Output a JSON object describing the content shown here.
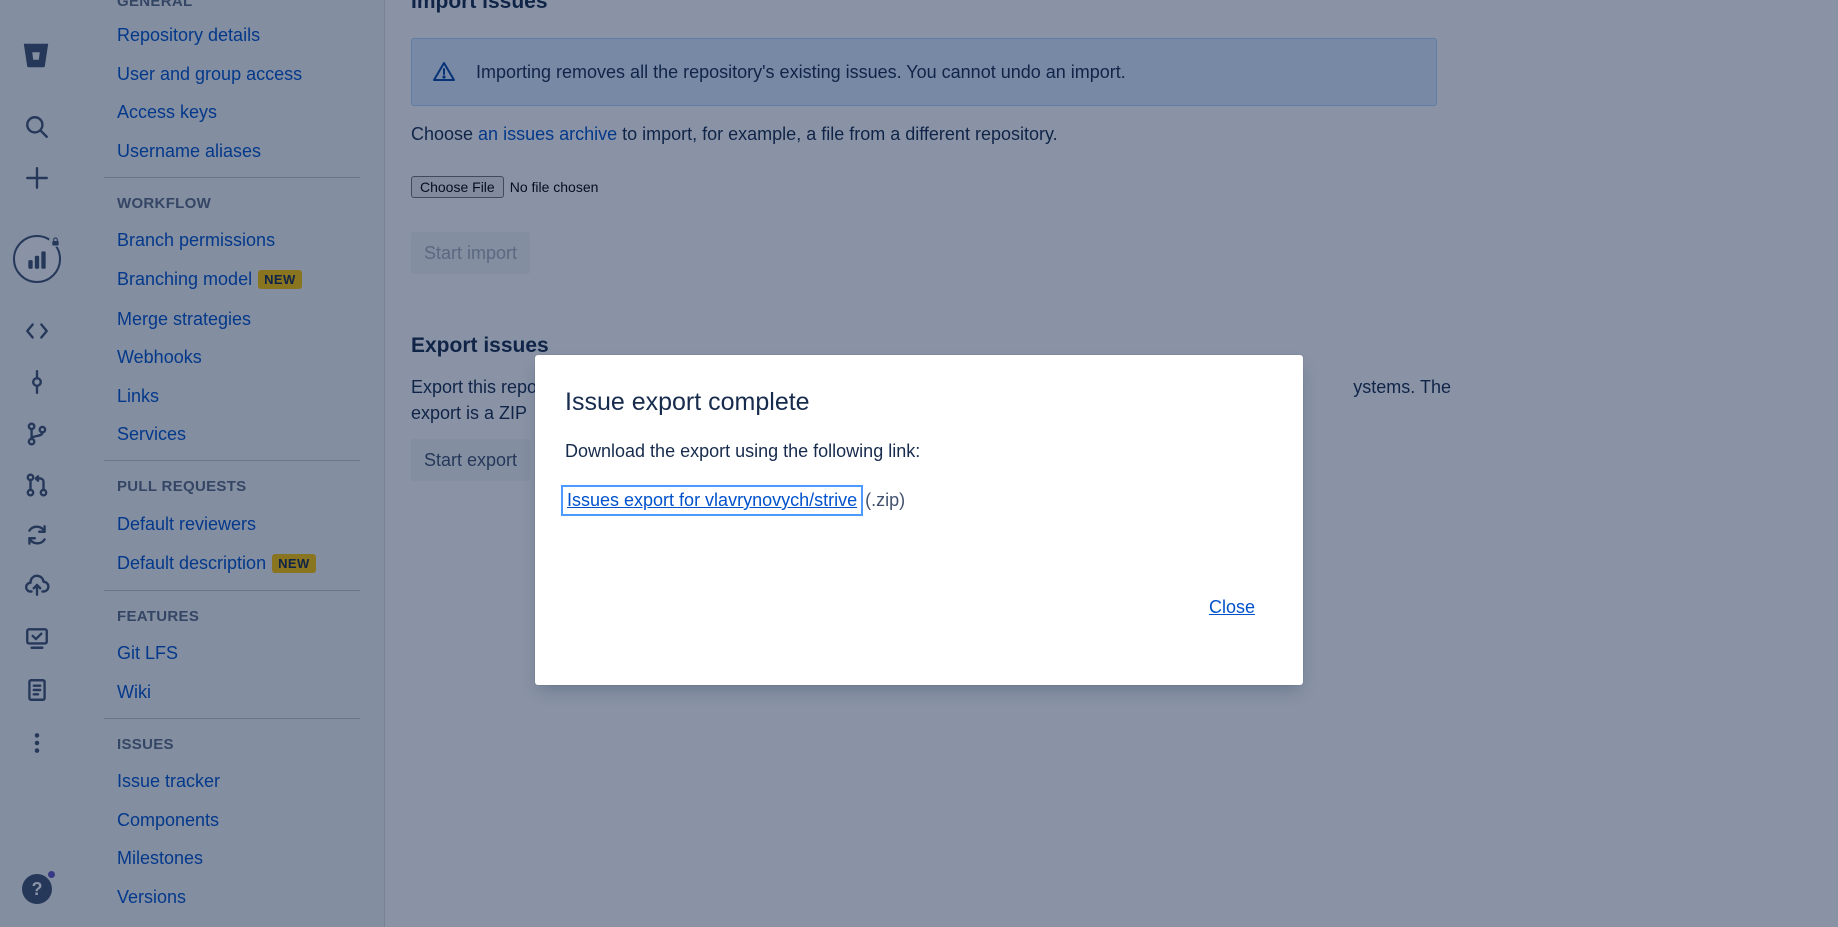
{
  "sidebar": {
    "heading_general": "GENERAL",
    "general_items": [
      "Repository details",
      "User and group access",
      "Access keys",
      "Username aliases"
    ],
    "heading_workflow": "WORKFLOW",
    "workflow_items": [
      "Branch permissions",
      "Branching model",
      "Merge strategies",
      "Webhooks",
      "Links",
      "Services"
    ],
    "heading_pull_requests": "PULL REQUESTS",
    "pr_items": [
      "Default reviewers",
      "Default description"
    ],
    "heading_features": "FEATURES",
    "features_items": [
      "Git LFS",
      "Wiki"
    ],
    "heading_issues": "ISSUES",
    "issues_items": [
      "Issue tracker",
      "Components",
      "Milestones",
      "Versions"
    ],
    "new_badge": "NEW"
  },
  "nav_icons": [
    "bitbucket-logo-icon",
    "search-icon",
    "plus-icon",
    "repo-avatar-icon",
    "code-icon",
    "commit-icon",
    "branch-icon",
    "pull-request-icon",
    "pipelines-icon",
    "deployments-icon",
    "jira-issues-icon",
    "document-icon",
    "more-icon",
    "help-icon"
  ],
  "main": {
    "import_title": "Import issues",
    "import_warning": "Importing removes all the repository's existing issues. You cannot undo an import.",
    "choose_prefix": "Choose ",
    "choose_link": "an issues archive",
    "choose_suffix": " to import, for example, a file from a different repository.",
    "choose_file_button": "Choose File",
    "no_file_chosen": "No file chosen",
    "start_import": "Start import",
    "export_title": "Export issues",
    "export_text_start": "Export this repo",
    "export_text_end": "ystems. The",
    "export_text_line2": "export is a ZIP",
    "start_export": "Start export"
  },
  "modal": {
    "title": "Issue export complete",
    "text": "Download the export using the following link:",
    "link": "Issues export for vlavrynovych/strive",
    "suffix": "(.zip)",
    "close": "Close"
  },
  "colors": {
    "link": "#0052cc",
    "badge": "#ffc400",
    "overlay": "rgba(9,30,66,0.48)"
  }
}
